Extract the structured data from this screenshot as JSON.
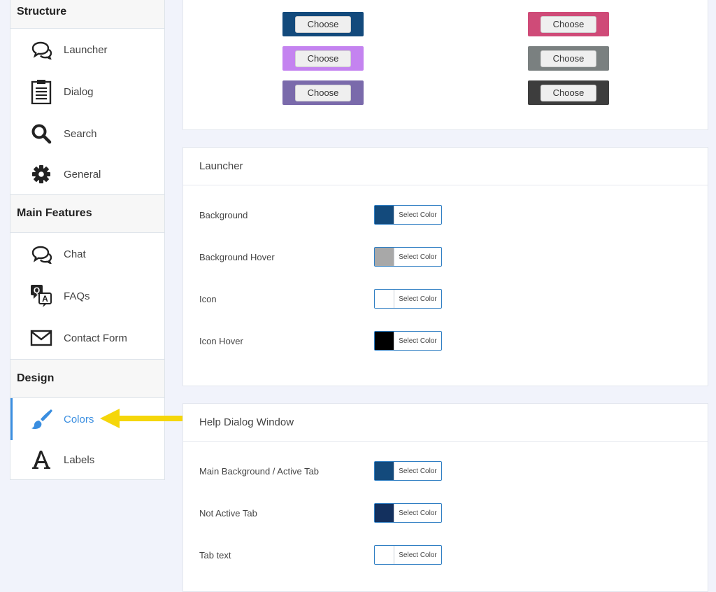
{
  "sidebar": {
    "groups": [
      {
        "title": "Structure",
        "items": [
          {
            "label": "Launcher",
            "icon": "chat-bubbles-icon"
          },
          {
            "label": "Dialog",
            "icon": "clipboard-icon"
          },
          {
            "label": "Search",
            "icon": "search-icon"
          },
          {
            "label": "General",
            "icon": "gear-icon"
          }
        ]
      },
      {
        "title": "Main Features",
        "items": [
          {
            "label": "Chat",
            "icon": "chat-bubbles-icon"
          },
          {
            "label": "FAQs",
            "icon": "qa-icon"
          },
          {
            "label": "Contact Form",
            "icon": "envelope-icon"
          }
        ]
      },
      {
        "title": "Design",
        "items": [
          {
            "label": "Colors",
            "icon": "brush-icon",
            "active": true
          },
          {
            "label": "Labels",
            "icon": "letter-a-icon"
          }
        ]
      }
    ]
  },
  "themes": {
    "choose_label": "Choose",
    "left": [
      "#1d4f86",
      "#134a7c",
      "#c483f0",
      "#7a6aab"
    ],
    "right": [
      "#e06b38",
      "#cf4b78",
      "#7a8080",
      "#3d3d3d"
    ]
  },
  "launcher": {
    "title": "Launcher",
    "select_label": "Select Color",
    "rows": [
      {
        "label": "Background",
        "color": "#134a7c"
      },
      {
        "label": "Background Hover",
        "color": "#a8a8a8"
      },
      {
        "label": "Icon",
        "color": "#ffffff"
      },
      {
        "label": "Icon Hover",
        "color": "#000000"
      }
    ]
  },
  "help_dialog": {
    "title": "Help Dialog Window",
    "select_label": "Select Color",
    "rows": [
      {
        "label": "Main Background / Active Tab",
        "color": "#134a7c"
      },
      {
        "label": "Not Active Tab",
        "color": "#13305e"
      },
      {
        "label": "Tab text",
        "color": "#ffffff"
      }
    ]
  },
  "colors": {
    "accent": "#3a8ee0",
    "arrow": "#f5d60a"
  }
}
